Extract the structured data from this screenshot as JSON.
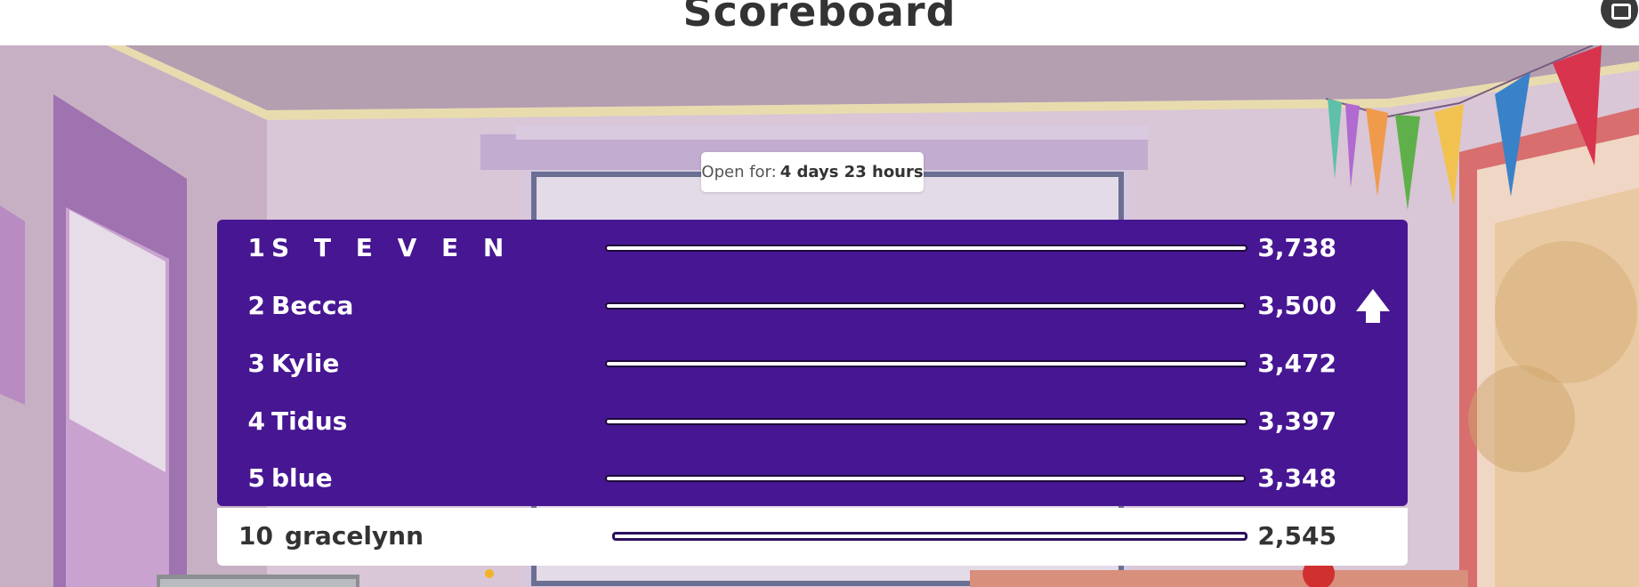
{
  "header": {
    "title": "Scoreboard",
    "corner_icon": "fullscreen-icon"
  },
  "timer": {
    "label": "Open for:",
    "value": "4 days 23 hours"
  },
  "leaderboard": {
    "rows": [
      {
        "rank": "1",
        "name": "S T E V E N",
        "score": "3,738",
        "score_value": 3738
      },
      {
        "rank": "2",
        "name": "Becca",
        "score": "3,500",
        "score_value": 3500,
        "trend_icon": "arrow-up-icon"
      },
      {
        "rank": "3",
        "name": "Kylie",
        "score": "3,472",
        "score_value": 3472
      },
      {
        "rank": "4",
        "name": "Tidus",
        "score": "3,397",
        "score_value": 3397
      },
      {
        "rank": "5",
        "name": "blue",
        "score": "3,348",
        "score_value": 3348
      }
    ],
    "current_player": {
      "rank": "10",
      "name": "gracelynn",
      "score": "2,545",
      "score_value": 2545
    }
  },
  "colors": {
    "board": "#471692",
    "board_text": "#ffffff",
    "highlight_row": "#ffffff",
    "highlight_text": "#333333"
  }
}
